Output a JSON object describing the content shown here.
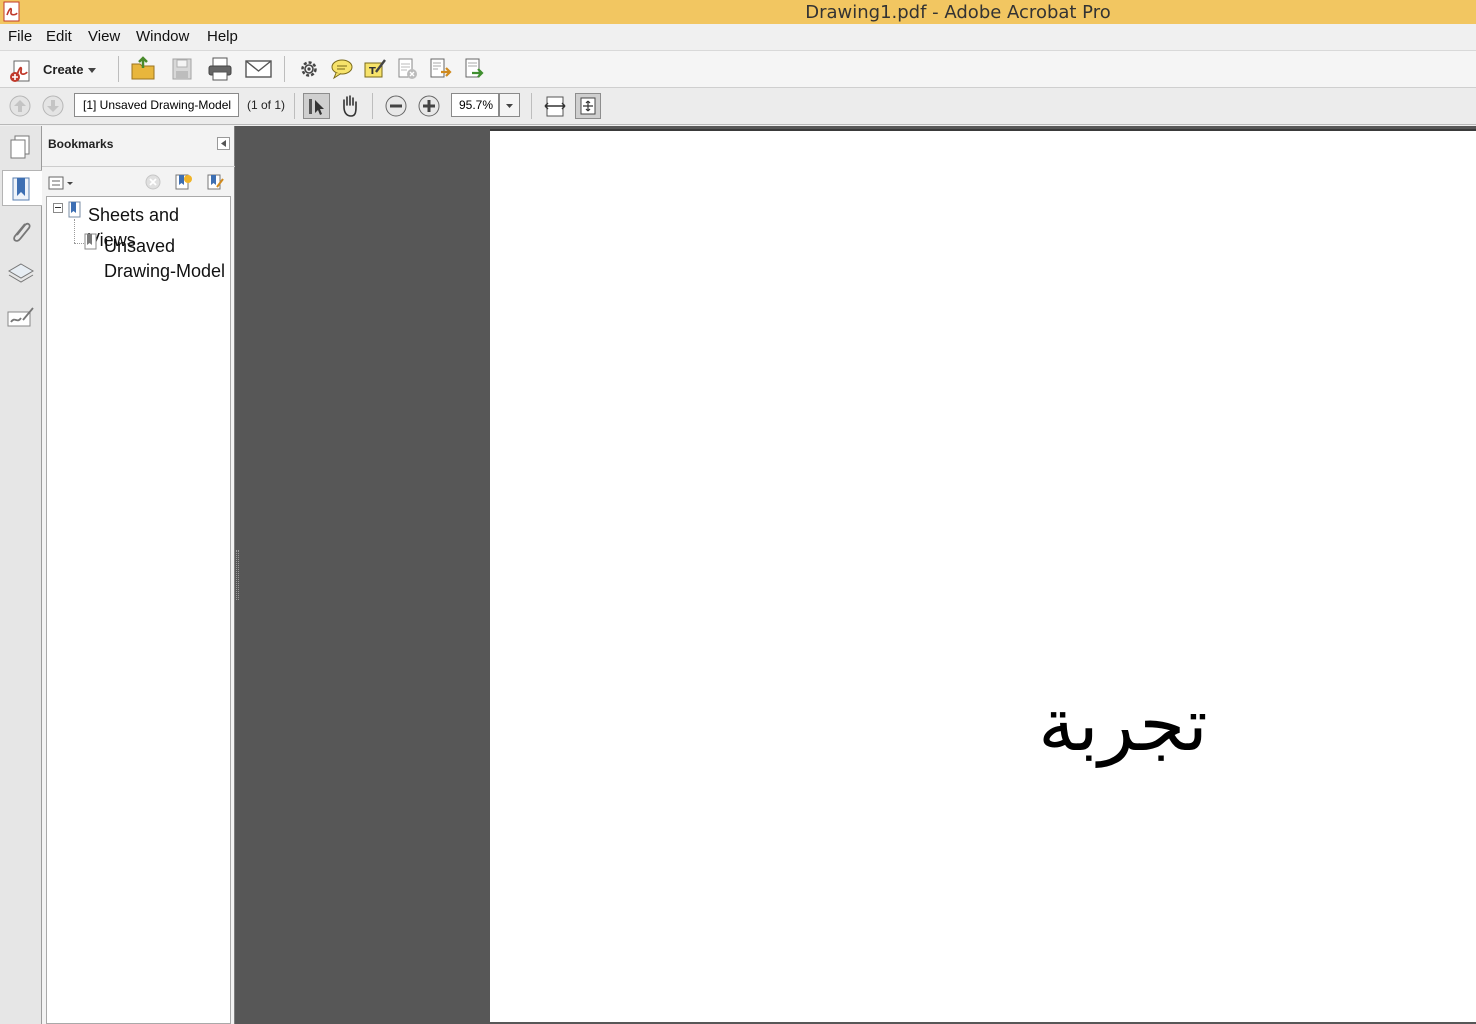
{
  "window": {
    "title": "Drawing1.pdf - Adobe Acrobat Pro"
  },
  "menu": {
    "items": [
      "File",
      "Edit",
      "View",
      "Window",
      "Help"
    ]
  },
  "toolbar": {
    "create_label": "Create",
    "icons": [
      "create-pdf-icon",
      "open-folder-icon",
      "save-icon",
      "print-icon",
      "email-icon",
      "settings-gear-icon",
      "comment-icon",
      "highlight-icon",
      "review-icon",
      "export-icon",
      "import-icon"
    ]
  },
  "nav_toolbar": {
    "page_field_value": "[1] Unsaved Drawing-Model",
    "page_count": "(1 of 1)",
    "zoom_value": "95.7%"
  },
  "bookmarks": {
    "title": "Bookmarks",
    "items": [
      {
        "label": "Sheets and Views",
        "level": 0,
        "expanded": true
      },
      {
        "label_line1": "Unsaved",
        "label_line2": "Drawing-Model",
        "level": 1
      }
    ]
  },
  "document": {
    "content_text": "تجربة"
  },
  "colors": {
    "titlebar": "#f2c661",
    "canvas": "#575757",
    "page": "#ffffff"
  }
}
